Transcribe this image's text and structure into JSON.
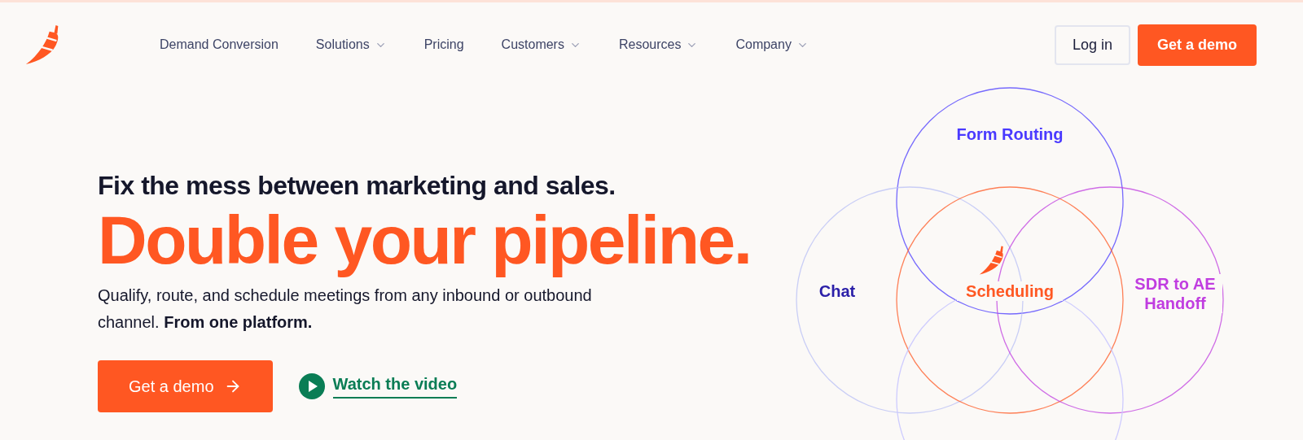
{
  "nav": {
    "items": [
      {
        "label": "Demand Conversion",
        "has_menu": false
      },
      {
        "label": "Solutions",
        "has_menu": true
      },
      {
        "label": "Pricing",
        "has_menu": false
      },
      {
        "label": "Customers",
        "has_menu": true
      },
      {
        "label": "Resources",
        "has_menu": true
      },
      {
        "label": "Company",
        "has_menu": true
      }
    ],
    "login": "Log in",
    "demo": "Get a demo"
  },
  "hero": {
    "kicker": "Fix the mess between marketing and sales.",
    "title": "Double your pipeline.",
    "body": "Qualify, route, and schedule meetings from any inbound or outbound channel. **From one platform.**",
    "primary": "Get a demo",
    "video": "Watch the video"
  },
  "diagram": {
    "circles": [
      {
        "label": "Form Routing",
        "color": "#4a3aff"
      },
      {
        "label": "Chat",
        "color": "#2b1fa8"
      },
      {
        "label": "Scheduling",
        "color": "#ff5722"
      },
      {
        "label": "SDR to AE Handoff",
        "color": "#c03de0"
      }
    ]
  }
}
